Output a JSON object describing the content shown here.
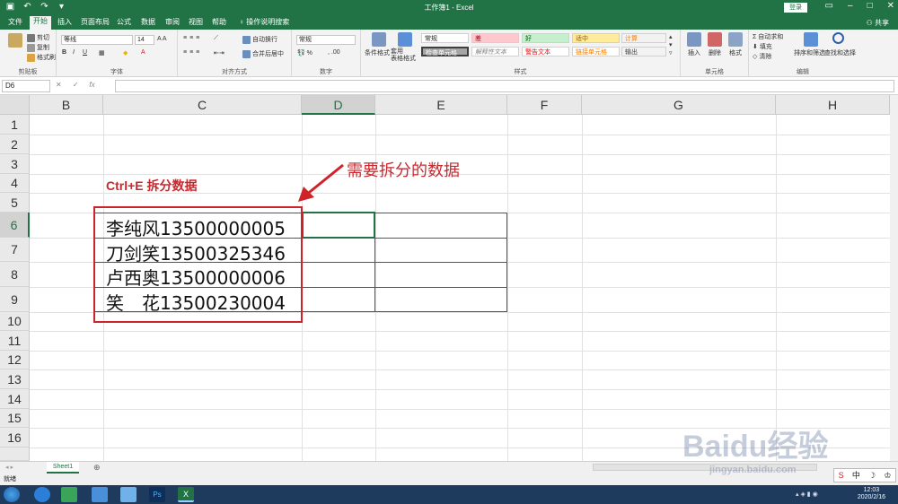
{
  "window": {
    "title": "工作簿1 - Excel",
    "login_label": "登录",
    "share_label": "共享"
  },
  "tabs": [
    "文件",
    "开始",
    "插入",
    "页面布局",
    "公式",
    "数据",
    "审阅",
    "视图",
    "帮助",
    "操作说明搜索"
  ],
  "ribbon": {
    "clipboard": {
      "cut": "剪切",
      "copy": "复制",
      "format_painter": "格式刷",
      "label": "剪贴板"
    },
    "font": {
      "name": "等线",
      "size": "14",
      "label": "字体"
    },
    "alignment": {
      "wrap": "自动换行",
      "merge": "合并后居中",
      "label": "对齐方式"
    },
    "number": {
      "format": "常规",
      "label": "数字"
    },
    "styles": {
      "conditional": "条件格式",
      "table": "套用\n表格格式",
      "normal": "常规",
      "bad": "差",
      "good": "好",
      "neutral": "适中",
      "calc": "计算",
      "check": "检查单元格",
      "explain": "解释性文本",
      "warn": "警告文本",
      "link": "链接单元格",
      "output": "输出",
      "label": "样式"
    },
    "cells": {
      "insert": "插入",
      "delete": "删除",
      "format": "格式",
      "label": "单元格"
    },
    "editing": {
      "autosum": "自动求和",
      "fill": "填充",
      "clear": "清除",
      "sort": "排序和筛选",
      "find": "查找和选择",
      "label": "编辑"
    }
  },
  "formula_bar": {
    "name_box": "D6",
    "cancel": "✕",
    "enter": "✓",
    "fx": "fx",
    "value": ""
  },
  "columns": [
    "B",
    "C",
    "D",
    "E",
    "F",
    "G",
    "H"
  ],
  "selected_column": "D",
  "rows": [
    "1",
    "2",
    "3",
    "4",
    "5",
    "6",
    "7",
    "8",
    "9",
    "10",
    "11",
    "12",
    "13",
    "14",
    "15",
    "16"
  ],
  "selected_row": "6",
  "cells": {
    "C6": "李纯风13500000005",
    "C7": "刀剑笑13500325346",
    "C8": "卢西奥13500000006",
    "C9": "笑　花13500230004"
  },
  "annotations": {
    "left_title": "Ctrl+E  拆分数据",
    "arrow_label": "需要拆分的数据"
  },
  "sheet_tabs": [
    "Sheet1"
  ],
  "add_sheet": "⊕",
  "status": "就绪",
  "clock": {
    "time": "12:03",
    "date": "2020/2/16"
  },
  "ime": "中",
  "watermark": {
    "logo": "Baidu经验",
    "url": "jingyan.baidu.com"
  },
  "colors": {
    "excel_green": "#217346",
    "annotation_red": "#d0222a",
    "taskbar": "#1e3a5c"
  }
}
